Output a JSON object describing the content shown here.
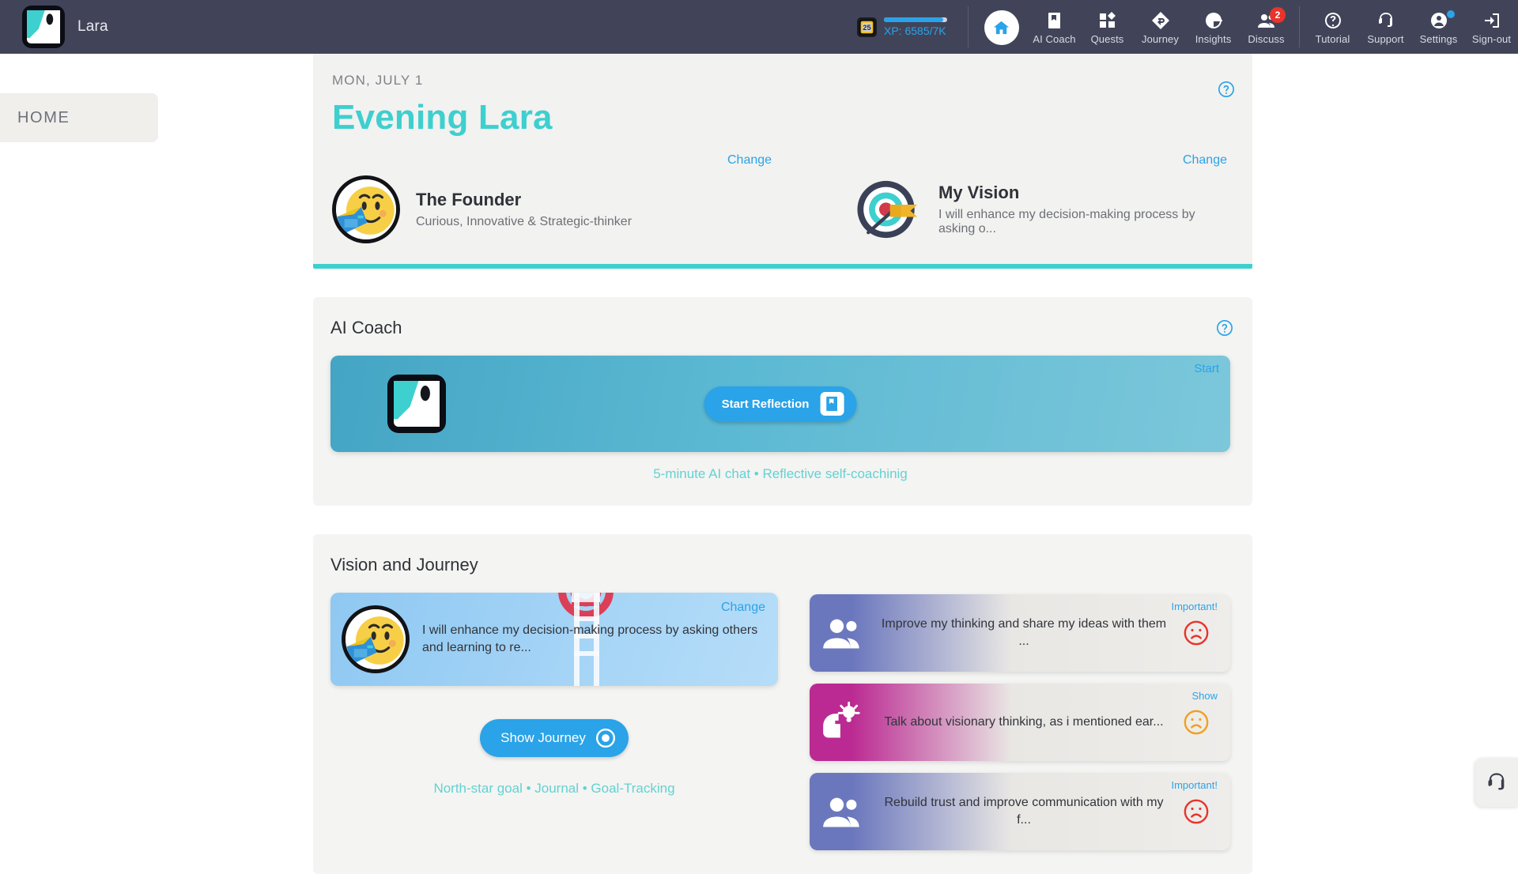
{
  "topbar": {
    "brand_name": "Lara",
    "brand_logo_icon": "lara-logo-icon",
    "xp": {
      "badge_icon": "xp-coin-icon",
      "text": "XP: 6585/7K",
      "progress_percent": 94
    },
    "nav_items": [
      {
        "label": "",
        "icon": "home-icon",
        "name": "home",
        "active": true
      },
      {
        "label": "AI Coach",
        "icon": "journal-icon",
        "name": "ai-coach"
      },
      {
        "label": "Quests",
        "icon": "quests-grid-icon",
        "name": "quests"
      },
      {
        "label": "Journey",
        "icon": "journey-diamond-icon",
        "name": "journey"
      },
      {
        "label": "Insights",
        "icon": "insights-pie-icon",
        "name": "insights"
      },
      {
        "label": "Discuss",
        "icon": "people-icon",
        "name": "discuss",
        "badge": "2"
      },
      {
        "label": "Tutorial",
        "icon": "question-circle-icon",
        "name": "tutorial"
      },
      {
        "label": "Support",
        "icon": "headset-icon",
        "name": "support"
      },
      {
        "label": "Settings",
        "icon": "account-circle-icon",
        "name": "settings",
        "dot": true
      },
      {
        "label": "Sign-out",
        "icon": "sign-out-icon",
        "name": "sign-out"
      }
    ]
  },
  "sidebar": {
    "home_tab_label": "HOME"
  },
  "hero": {
    "date": "MON, JULY 1",
    "greeting": "Evening Lara",
    "help_icon": "help-circle-icon",
    "persona": {
      "title": "The Founder",
      "subtitle": "Curious, Innovative & Strategic-thinker",
      "change_label": "Change",
      "avatar_icon": "founder-avatar-icon"
    },
    "vision": {
      "title": "My Vision",
      "subtitle": "I will enhance my decision-making process by asking o...",
      "change_label": "Change",
      "icon": "target-dartboard-icon"
    },
    "accent_color": "#3ecfcf"
  },
  "ai_coach": {
    "panel_title": "AI Coach",
    "help_icon": "help-circle-icon",
    "banner": {
      "logo_icon": "lara-logo-icon",
      "button_label": "Start Reflection",
      "button_icon": "journal-icon",
      "corner_label": "Start"
    },
    "subtitle": "5-minute AI chat • Reflective self-coachinig"
  },
  "vision_journey": {
    "panel_title": "Vision and Journey",
    "vision_card": {
      "text": "I will enhance my decision-making process by asking others and learning to re...",
      "change_label": "Change",
      "avatar_icon": "founder-avatar-icon",
      "background_icon": "ladder-target-icon"
    },
    "show_journey_label": "Show Journey",
    "show_journey_icon": "record-circle-icon",
    "links": "North-star goal • Journal • Goal-Tracking",
    "goal_cards": [
      {
        "text": "Improve my thinking and share my ideas with them ...",
        "corner_label": "Important!",
        "icon": "people-icon",
        "face_icon": "sad-face-icon",
        "face_color": "#e8342b",
        "gradient_color": "#6b77bd"
      },
      {
        "text": "Talk about visionary thinking, as i mentioned ear...",
        "corner_label": "Show",
        "icon": "head-lightbulb-icon",
        "face_icon": "sad-face-icon",
        "face_color": "#f0a020",
        "gradient_color": "#bb2a92"
      },
      {
        "text": "Rebuild trust and improve communication with my f...",
        "corner_label": "Important!",
        "icon": "people-icon",
        "face_icon": "sad-face-icon",
        "face_color": "#e8342b",
        "gradient_color": "#6b77bd"
      }
    ]
  },
  "support_fab": {
    "icon": "headset-icon"
  }
}
